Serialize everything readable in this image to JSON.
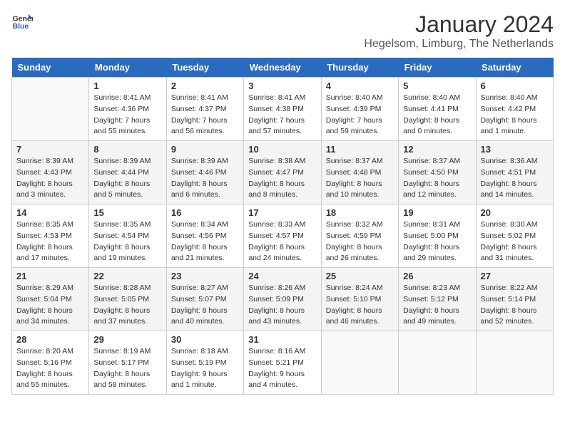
{
  "header": {
    "logo_line1": "General",
    "logo_line2": "Blue",
    "month_title": "January 2024",
    "location": "Hegelsom, Limburg, The Netherlands"
  },
  "weekdays": [
    "Sunday",
    "Monday",
    "Tuesday",
    "Wednesday",
    "Thursday",
    "Friday",
    "Saturday"
  ],
  "weeks": [
    [
      {
        "day": "",
        "info": ""
      },
      {
        "day": "1",
        "info": "Sunrise: 8:41 AM\nSunset: 4:36 PM\nDaylight: 7 hours\nand 55 minutes."
      },
      {
        "day": "2",
        "info": "Sunrise: 8:41 AM\nSunset: 4:37 PM\nDaylight: 7 hours\nand 56 minutes."
      },
      {
        "day": "3",
        "info": "Sunrise: 8:41 AM\nSunset: 4:38 PM\nDaylight: 7 hours\nand 57 minutes."
      },
      {
        "day": "4",
        "info": "Sunrise: 8:40 AM\nSunset: 4:39 PM\nDaylight: 7 hours\nand 59 minutes."
      },
      {
        "day": "5",
        "info": "Sunrise: 8:40 AM\nSunset: 4:41 PM\nDaylight: 8 hours\nand 0 minutes."
      },
      {
        "day": "6",
        "info": "Sunrise: 8:40 AM\nSunset: 4:42 PM\nDaylight: 8 hours\nand 1 minute."
      }
    ],
    [
      {
        "day": "7",
        "info": "Sunrise: 8:39 AM\nSunset: 4:43 PM\nDaylight: 8 hours\nand 3 minutes."
      },
      {
        "day": "8",
        "info": "Sunrise: 8:39 AM\nSunset: 4:44 PM\nDaylight: 8 hours\nand 5 minutes."
      },
      {
        "day": "9",
        "info": "Sunrise: 8:39 AM\nSunset: 4:46 PM\nDaylight: 8 hours\nand 6 minutes."
      },
      {
        "day": "10",
        "info": "Sunrise: 8:38 AM\nSunset: 4:47 PM\nDaylight: 8 hours\nand 8 minutes."
      },
      {
        "day": "11",
        "info": "Sunrise: 8:37 AM\nSunset: 4:48 PM\nDaylight: 8 hours\nand 10 minutes."
      },
      {
        "day": "12",
        "info": "Sunrise: 8:37 AM\nSunset: 4:50 PM\nDaylight: 8 hours\nand 12 minutes."
      },
      {
        "day": "13",
        "info": "Sunrise: 8:36 AM\nSunset: 4:51 PM\nDaylight: 8 hours\nand 14 minutes."
      }
    ],
    [
      {
        "day": "14",
        "info": "Sunrise: 8:35 AM\nSunset: 4:53 PM\nDaylight: 8 hours\nand 17 minutes."
      },
      {
        "day": "15",
        "info": "Sunrise: 8:35 AM\nSunset: 4:54 PM\nDaylight: 8 hours\nand 19 minutes."
      },
      {
        "day": "16",
        "info": "Sunrise: 8:34 AM\nSunset: 4:56 PM\nDaylight: 8 hours\nand 21 minutes."
      },
      {
        "day": "17",
        "info": "Sunrise: 8:33 AM\nSunset: 4:57 PM\nDaylight: 8 hours\nand 24 minutes."
      },
      {
        "day": "18",
        "info": "Sunrise: 8:32 AM\nSunset: 4:59 PM\nDaylight: 8 hours\nand 26 minutes."
      },
      {
        "day": "19",
        "info": "Sunrise: 8:31 AM\nSunset: 5:00 PM\nDaylight: 8 hours\nand 29 minutes."
      },
      {
        "day": "20",
        "info": "Sunrise: 8:30 AM\nSunset: 5:02 PM\nDaylight: 8 hours\nand 31 minutes."
      }
    ],
    [
      {
        "day": "21",
        "info": "Sunrise: 8:29 AM\nSunset: 5:04 PM\nDaylight: 8 hours\nand 34 minutes."
      },
      {
        "day": "22",
        "info": "Sunrise: 8:28 AM\nSunset: 5:05 PM\nDaylight: 8 hours\nand 37 minutes."
      },
      {
        "day": "23",
        "info": "Sunrise: 8:27 AM\nSunset: 5:07 PM\nDaylight: 8 hours\nand 40 minutes."
      },
      {
        "day": "24",
        "info": "Sunrise: 8:26 AM\nSunset: 5:09 PM\nDaylight: 8 hours\nand 43 minutes."
      },
      {
        "day": "25",
        "info": "Sunrise: 8:24 AM\nSunset: 5:10 PM\nDaylight: 8 hours\nand 46 minutes."
      },
      {
        "day": "26",
        "info": "Sunrise: 8:23 AM\nSunset: 5:12 PM\nDaylight: 8 hours\nand 49 minutes."
      },
      {
        "day": "27",
        "info": "Sunrise: 8:22 AM\nSunset: 5:14 PM\nDaylight: 8 hours\nand 52 minutes."
      }
    ],
    [
      {
        "day": "28",
        "info": "Sunrise: 8:20 AM\nSunset: 5:16 PM\nDaylight: 8 hours\nand 55 minutes."
      },
      {
        "day": "29",
        "info": "Sunrise: 8:19 AM\nSunset: 5:17 PM\nDaylight: 8 hours\nand 58 minutes."
      },
      {
        "day": "30",
        "info": "Sunrise: 8:18 AM\nSunset: 5:19 PM\nDaylight: 9 hours\nand 1 minute."
      },
      {
        "day": "31",
        "info": "Sunrise: 8:16 AM\nSunset: 5:21 PM\nDaylight: 9 hours\nand 4 minutes."
      },
      {
        "day": "",
        "info": ""
      },
      {
        "day": "",
        "info": ""
      },
      {
        "day": "",
        "info": ""
      }
    ]
  ]
}
